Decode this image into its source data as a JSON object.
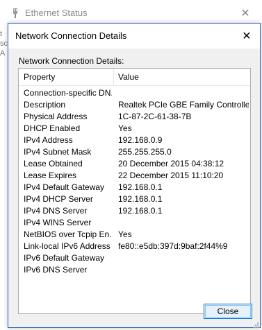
{
  "background_window": {
    "title": "Ethernet Status",
    "left_edge_fragments": [
      "t",
      "sc",
      "A"
    ]
  },
  "dialog": {
    "title": "Network Connection Details",
    "group_label": "Network Connection Details:",
    "columns": [
      "Property",
      "Value"
    ],
    "rows": [
      {
        "property": "Connection-specific DN...",
        "value": ""
      },
      {
        "property": "Description",
        "value": "Realtek PCIe GBE Family Controller"
      },
      {
        "property": "Physical Address",
        "value": "1C-87-2C-61-38-7B"
      },
      {
        "property": "DHCP Enabled",
        "value": "Yes"
      },
      {
        "property": "IPv4 Address",
        "value": "192.168.0.9"
      },
      {
        "property": "IPv4 Subnet Mask",
        "value": "255.255.255.0"
      },
      {
        "property": "Lease Obtained",
        "value": "20 December 2015 04:38:12"
      },
      {
        "property": "Lease Expires",
        "value": "22 December 2015 11:10:20"
      },
      {
        "property": "IPv4 Default Gateway",
        "value": "192.168.0.1"
      },
      {
        "property": "IPv4 DHCP Server",
        "value": "192.168.0.1"
      },
      {
        "property": "IPv4 DNS Server",
        "value": "192.168.0.1"
      },
      {
        "property": "IPv4 WINS Server",
        "value": ""
      },
      {
        "property": "NetBIOS over Tcpip En...",
        "value": "Yes"
      },
      {
        "property": "Link-local IPv6 Address",
        "value": "fe80::e5db:397d:9baf:2f44%9"
      },
      {
        "property": "IPv6 Default Gateway",
        "value": ""
      },
      {
        "property": "IPv6 DNS Server",
        "value": ""
      }
    ],
    "close_button_label": "Close"
  },
  "colors": {
    "dialog_border": "#2b6cc4",
    "button_border": "#0078d7",
    "button_fill": "#e5f1fb"
  },
  "icons": {
    "background_window_icon": "network-adapter-icon",
    "close": "close-icon"
  }
}
